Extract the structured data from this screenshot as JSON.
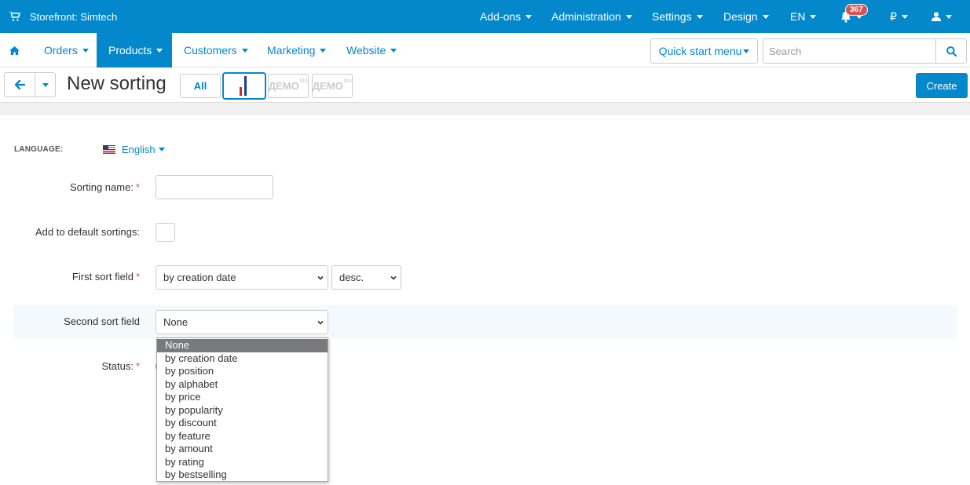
{
  "topbar": {
    "store_label": "Storefront: Simtech",
    "menu": [
      "Add-ons",
      "Administration",
      "Settings",
      "Design",
      "EN"
    ],
    "notifications_count": "367",
    "currency": "₽"
  },
  "nav": {
    "items": [
      "Orders",
      "Products",
      "Customers",
      "Marketing",
      "Website"
    ],
    "active": "Products",
    "quick_start": "Quick start menu",
    "search_placeholder": "Search"
  },
  "toolbar": {
    "title": "New sorting",
    "all_label": "All",
    "demo_label": "ДЕМО",
    "demo_sup": "MA",
    "create_label": "Create"
  },
  "form": {
    "language_label": "LANGUAGE:",
    "language_value": "English",
    "sorting_name_label": "Sorting name:",
    "sorting_name_value": "",
    "add_default_label": "Add to default sortings:",
    "first_sort_label": "First sort field",
    "first_sort_value": "by creation date",
    "first_sort_order": "desc.",
    "second_sort_label": "Second sort field",
    "second_sort_value": "None",
    "status_label": "Status:",
    "required_mark": "*"
  },
  "dropdown": {
    "options": [
      "None",
      "by creation date",
      "by position",
      "by alphabet",
      "by price",
      "by popularity",
      "by discount",
      "by feature",
      "by amount",
      "by rating",
      "by bestselling"
    ],
    "selected": "None"
  },
  "colors": {
    "primary": "#0388cc",
    "badge": "#d9534f",
    "required": "#d9534f"
  }
}
